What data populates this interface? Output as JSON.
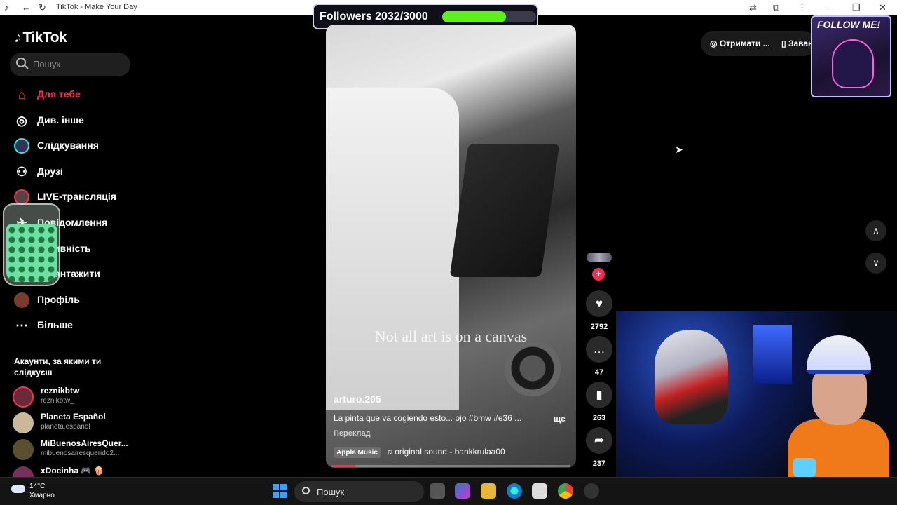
{
  "window": {
    "title": "TikTok - Make Your Day"
  },
  "sidebar": {
    "logo": "TikTok",
    "search_placeholder": "Пошук",
    "nav": [
      {
        "label": "Для тебе",
        "icon": "home-icon",
        "active": true
      },
      {
        "label": "Див. інше",
        "icon": "compass-icon",
        "active": false
      },
      {
        "label": "Слідкування",
        "icon": "following-avatar-icon",
        "active": false
      },
      {
        "label": "Друзі",
        "icon": "friends-icon",
        "active": false
      },
      {
        "label": "LIVE-трансляція",
        "icon": "live-icon",
        "active": false
      },
      {
        "label": "Повідомлення",
        "icon": "messages-icon",
        "active": false
      },
      {
        "label": "Активність",
        "icon": "activity-icon",
        "active": false
      },
      {
        "label": "Завантажити",
        "icon": "upload-icon",
        "active": false
      },
      {
        "label": "Профіль",
        "icon": "profile-avatar-icon",
        "active": false
      },
      {
        "label": "Більше",
        "icon": "more-icon",
        "active": false
      }
    ],
    "section_title": "Акаунти, за якими ти слідкуєш",
    "accounts": [
      {
        "name": "reznikbtw",
        "handle": "reznikbtw_"
      },
      {
        "name": "Planeta Español",
        "handle": "planeta.espanol"
      },
      {
        "name": "MiBuenosAiresQuer...",
        "handle": "mibuenosairesquerido2..."
      },
      {
        "name": "xDocinha 🎮 🍿",
        "handle": ""
      }
    ]
  },
  "overlay": {
    "followers_text": "Followers 2032/3000",
    "followers_progress": 0.677,
    "follow_me": "FOLLOW ME!"
  },
  "video": {
    "caption_overlay": "Not all art is on a canvas",
    "username": "arturo.205",
    "description": "La pinta que va cogiendo esto... ojo #bmw #e36 ...",
    "more_label": "ще",
    "translate_label": "Переклад",
    "music_badge": "Apple Music",
    "music_title": "original sound - bankkrulaa00",
    "playback_progress": 0.1
  },
  "actions": {
    "likes": "2792",
    "comments": "47",
    "saves": "263",
    "shares": "237"
  },
  "top_right": {
    "get_coins": "Отримати ...",
    "download": "Завантаж..."
  },
  "taskbar": {
    "temperature": "14°C",
    "weather": "Хмарно",
    "search_label": "Пошук"
  },
  "colors": {
    "accent": "#fe2c55",
    "progress_green": "#5ef01a"
  }
}
